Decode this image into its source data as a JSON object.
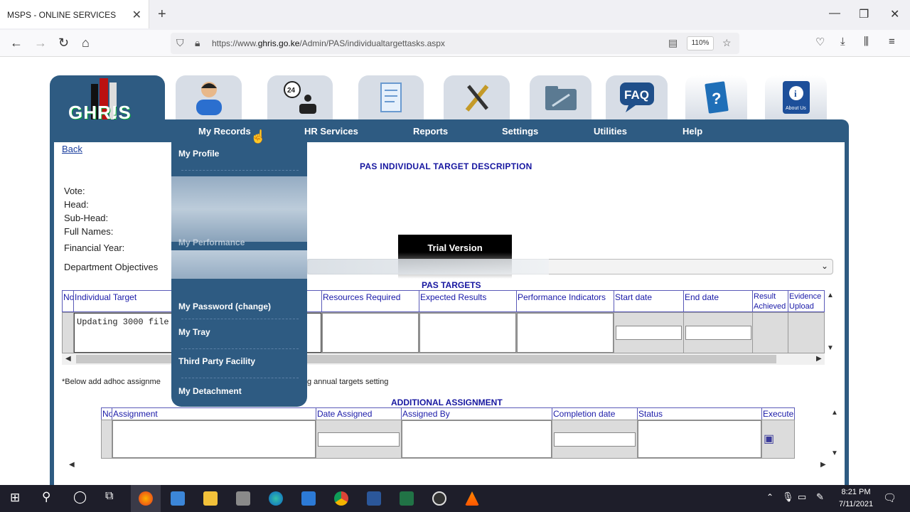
{
  "browser": {
    "tab_title": "MSPS - ONLINE SERVICES",
    "url_prefix": "https://www.",
    "url_domain": "ghris.go.ke",
    "url_path": "/Admin/PAS/individualtargettasks.aspx",
    "zoom": "110%"
  },
  "logo": {
    "text": "GHR!S"
  },
  "top_icons": [
    "user-icon",
    "hr-services-24-icon",
    "reports-document-icon",
    "settings-tools-icon",
    "utilities-folder-icon",
    "faq-icon",
    "help-book-icon",
    "about-us-icon"
  ],
  "icon_labels": {
    "faq": "FAQ",
    "about": "About Us",
    "hours": "24"
  },
  "menu": {
    "my_records": "My Records",
    "hr_services": "HR Services",
    "reports": "Reports",
    "settings": "Settings",
    "utilities": "Utilities",
    "help": "Help"
  },
  "dropdown": {
    "my_profile": "My Profile",
    "my_performance": "My Performance",
    "my_password": "My Password (change)",
    "my_tray": "My Tray",
    "third_party": "Third Party Facility",
    "my_detachment": "My Detachment"
  },
  "page": {
    "back": "Back",
    "title": "PAS  INDIVIDUAL TARGET DESCRIPTION",
    "labels": {
      "vote": "Vote:",
      "head": "Head:",
      "sub_head": "Sub-Head:",
      "full_names": "Full Names:",
      "financial_year": "Financial Year:",
      "department_objectives": "Department Objectives"
    },
    "trial": "Trial Version",
    "pas_targets_title": "PAS TARGETS",
    "note_left": "*Below add adhoc assignme",
    "note_right": "g annual targets setting",
    "additional_title": "ADDITIONAL ASSIGNMENT"
  },
  "targets_table": {
    "headers": {
      "no": "No",
      "individual_target": "Individual Target",
      "resources": "Resources Required",
      "expected": "Expected Results",
      "indicators": "Performance Indicators",
      "start": "Start date",
      "end": "End date",
      "result": "Result Achieved",
      "evidence": "Evidence Upload"
    },
    "row1_target": "Updating 3000 file"
  },
  "additional_table": {
    "headers": {
      "no": "No",
      "assignment": "Assignment",
      "date_assigned": "Date Assigned",
      "assigned_by": "Assigned By",
      "completion": "Completion date",
      "status": "Status",
      "execute": "Execute"
    }
  },
  "taskbar": {
    "time": "8:21 PM",
    "date": "7/11/2021"
  }
}
